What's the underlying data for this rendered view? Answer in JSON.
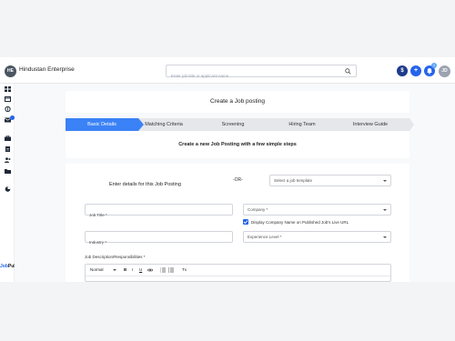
{
  "org": {
    "logo_text": "HE",
    "name": "Hindustan Enterprise"
  },
  "header": {
    "search_placeholder": "Enter job title or applicant name",
    "dollar_label": "$",
    "plus_label": "+",
    "notification_count": "1",
    "avatar_initials": "JD"
  },
  "brand": {
    "part1": "Job",
    "part2": "Pulse"
  },
  "page": {
    "title": "Create a Job posting",
    "subtitle": "Create a new Job Posting with a few simple steps"
  },
  "steps": [
    "Basic Details",
    "Matching Criteria",
    "Screening",
    "Hiring Team",
    "Interview Guide"
  ],
  "active_step": 0,
  "form": {
    "intro": "Enter details for this Job Posting",
    "or_label": "-OR-",
    "template_placeholder": "Select a job template",
    "job_title_placeholder": "Job Title *",
    "company_placeholder": "Company *",
    "display_company_label": "Display Company Name on Published Job's Live URL",
    "display_company_checked": true,
    "industry_placeholder": "Industry *",
    "experience_placeholder": "Experience Level *",
    "description_label": "Job Description/Responsibilities *"
  },
  "editor_toolbar": {
    "format": "Normal",
    "clear_label": "Tx"
  },
  "colors": {
    "primary": "#3b82f6",
    "dark_blue": "#1e3a8a",
    "accent": "#2563eb"
  }
}
